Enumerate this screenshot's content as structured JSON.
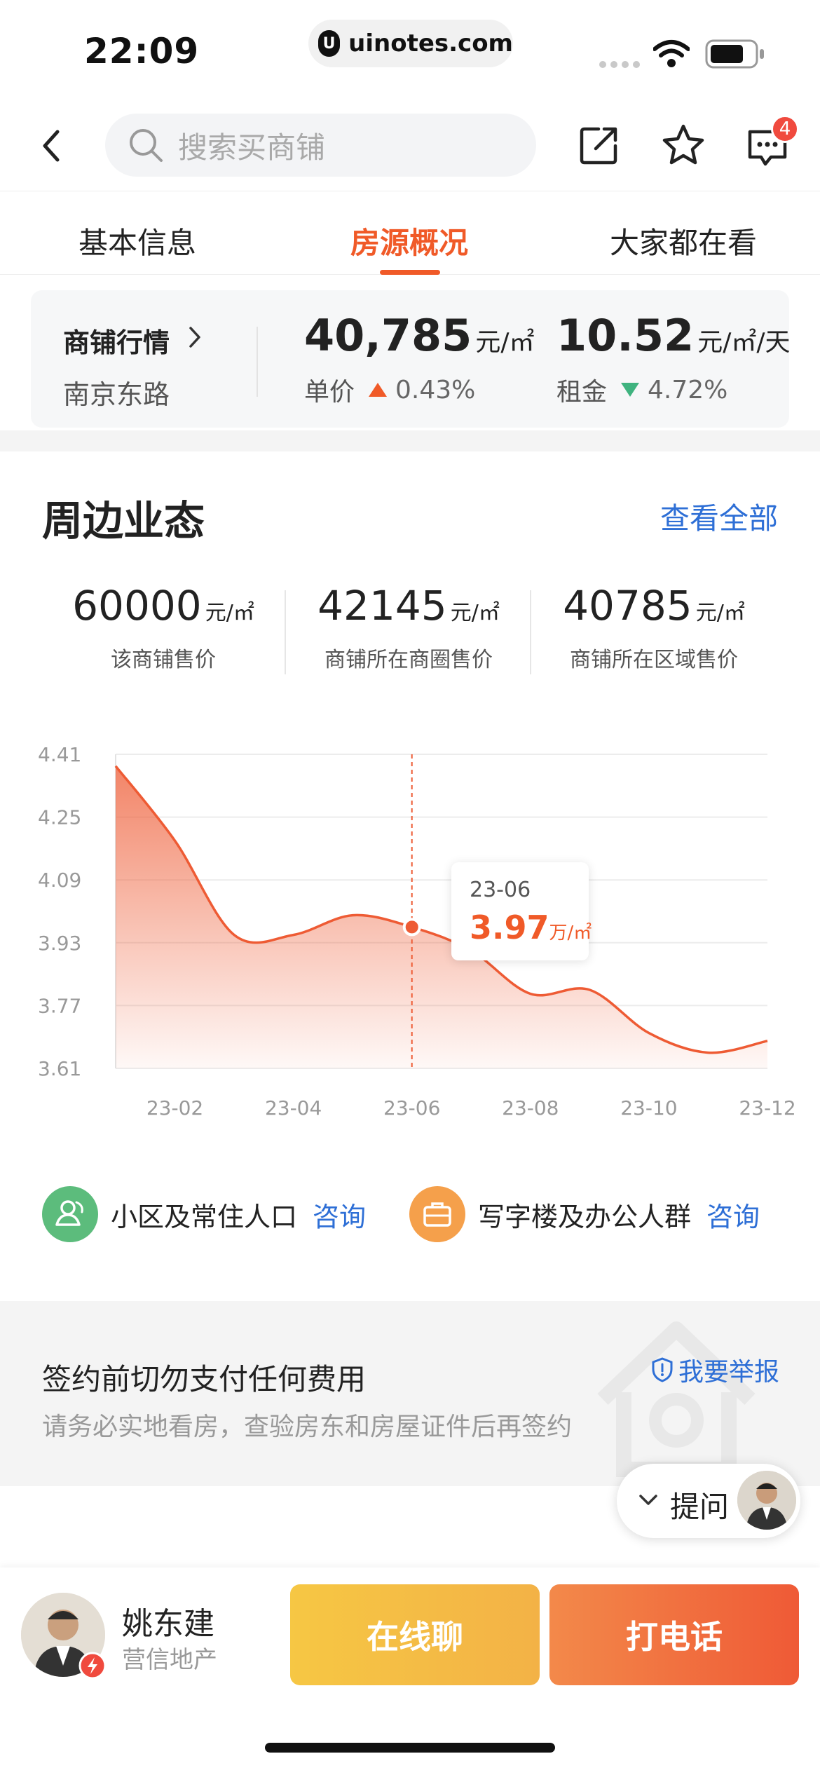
{
  "status_bar": {
    "time": "22:09",
    "url": "uinotes.com",
    "icons": [
      "signal-icon",
      "wifi-icon",
      "battery-icon"
    ]
  },
  "nav": {
    "search_placeholder": "搜索买商铺",
    "message_badge": "4",
    "icons": [
      "back-icon",
      "search-icon",
      "share-icon",
      "star-icon",
      "message-icon"
    ]
  },
  "tabs": [
    {
      "label": "基本信息",
      "active": false
    },
    {
      "label": "房源概况",
      "active": true
    },
    {
      "label": "大家都在看",
      "active": false
    }
  ],
  "market": {
    "title": "商铺行情",
    "location": "南京东路",
    "price_value": "40,785",
    "price_unit": "元/㎡",
    "price_label": "单价",
    "price_change": "0.43%",
    "price_trend": "up",
    "rent_value": "10.52",
    "rent_unit": "元/㎡/天",
    "rent_label": "租金",
    "rent_change": "4.72%",
    "rent_trend": "down",
    "colors": {
      "up": "#f05a28",
      "down": "#3fb37f"
    }
  },
  "surroundings": {
    "title": "周边业态",
    "view_all": "查看全部",
    "stats": [
      {
        "value": "60000",
        "unit": "元/㎡",
        "label": "该商铺售价"
      },
      {
        "value": "42145",
        "unit": "元/㎡",
        "label": "商铺所在商圈售价"
      },
      {
        "value": "40785",
        "unit": "元/㎡",
        "label": "商铺所在区域售价"
      }
    ]
  },
  "chart_data": {
    "type": "area",
    "x": [
      "23-01",
      "23-02",
      "23-03",
      "23-04",
      "23-05",
      "23-06",
      "23-07",
      "23-08",
      "23-09",
      "23-10",
      "23-11",
      "23-12"
    ],
    "xticks": [
      "23-02",
      "23-04",
      "23-06",
      "23-08",
      "23-10",
      "23-12"
    ],
    "values": [
      4.38,
      4.19,
      3.95,
      3.95,
      4.0,
      3.97,
      3.91,
      3.8,
      3.81,
      3.7,
      3.65,
      3.68
    ],
    "yticks": [
      "4.41",
      "4.25",
      "4.09",
      "3.93",
      "3.77",
      "3.61"
    ],
    "ylim": [
      3.61,
      4.41
    ],
    "grid": true,
    "color": "#ee5b34",
    "highlight": {
      "x": "23-06",
      "value": "3.97",
      "unit": "万/㎡"
    }
  },
  "population": [
    {
      "label": "小区及常住人口",
      "action": "咨询",
      "icon": "person-icon",
      "color": "#5cbc7c"
    },
    {
      "label": "写字楼及办公人群",
      "action": "咨询",
      "icon": "briefcase-icon",
      "color": "#f5a04b"
    }
  ],
  "warning": {
    "title": "签约前切勿支付任何费用",
    "subtitle": "请务必实地看房，查验房东和房屋证件后再签约",
    "report": "我要举报"
  },
  "ask": {
    "label": "提问"
  },
  "agent": {
    "name": "姚东建",
    "company": "营信地产",
    "chat_label": "在线聊",
    "call_label": "打电话"
  }
}
